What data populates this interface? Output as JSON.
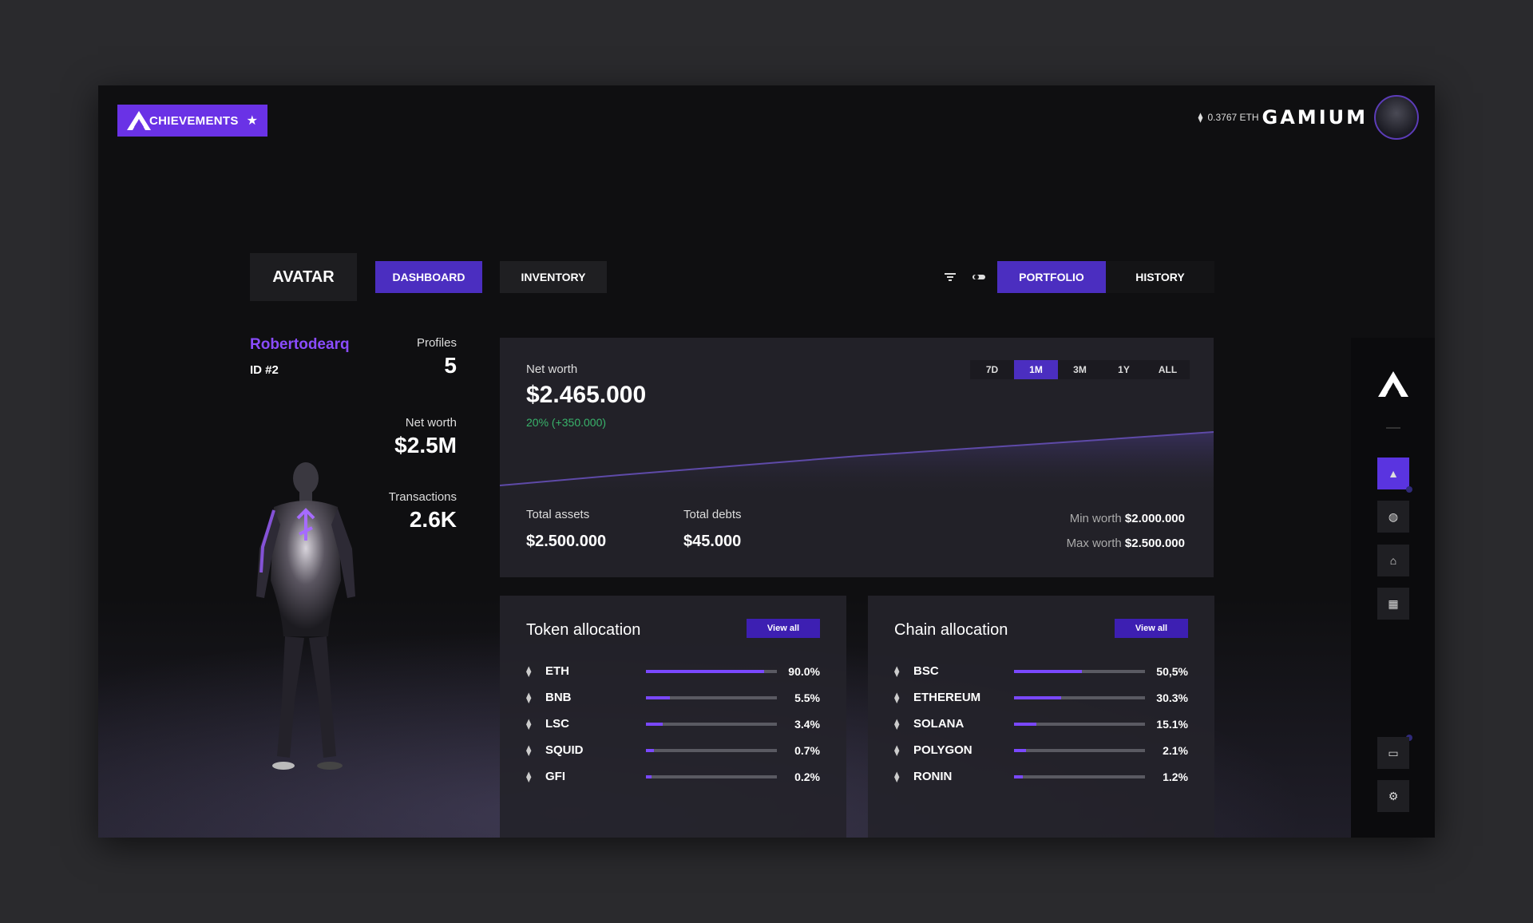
{
  "header": {
    "achievements_label": "CHIEVEMENTS",
    "eth_balance": "0.3767 ETH",
    "brand": "GAMIUM"
  },
  "nav": {
    "avatar": "AVATAR",
    "dashboard": "DASHBOARD",
    "inventory": "INVENTORY",
    "portfolio": "PORTFOLIO",
    "history": "HISTORY"
  },
  "profile": {
    "username": "Robertodearq",
    "id": "ID #2",
    "profiles_label": "Profiles",
    "profiles_value": "5",
    "networth_label": "Net worth",
    "networth_value": "$2.5M",
    "transactions_label": "Transactions",
    "transactions_value": "2.6K"
  },
  "networth": {
    "label": "Net worth",
    "value": "$2.465.000",
    "change": "20% (+350.000)",
    "ranges": [
      "7D",
      "1M",
      "3M",
      "1Y",
      "ALL"
    ],
    "active_range": "1M",
    "total_assets_label": "Total assets",
    "total_assets_value": "$2.500.000",
    "total_debts_label": "Total debts",
    "total_debts_value": "$45.000",
    "min_label": "Min worth",
    "min_value": "$2.000.000",
    "max_label": "Max worth",
    "max_value": "$2.500.000"
  },
  "token_allocation": {
    "title": "Token allocation",
    "view_all": "View all",
    "items": [
      {
        "name": "ETH",
        "pct": "90.0%",
        "fill": 0.9
      },
      {
        "name": "BNB",
        "pct": "5.5%",
        "fill": 0.18
      },
      {
        "name": "LSC",
        "pct": "3.4%",
        "fill": 0.13
      },
      {
        "name": "SQUID",
        "pct": "0.7%",
        "fill": 0.06
      },
      {
        "name": "GFI",
        "pct": "0.2%",
        "fill": 0.04
      }
    ]
  },
  "chain_allocation": {
    "title": "Chain allocation",
    "view_all": "View all",
    "items": [
      {
        "name": "BSC",
        "pct": "50,5%",
        "fill": 0.52
      },
      {
        "name": "ETHEREUM",
        "pct": "30.3%",
        "fill": 0.36
      },
      {
        "name": "SOLANA",
        "pct": "15.1%",
        "fill": 0.17
      },
      {
        "name": "POLYGON",
        "pct": "2.1%",
        "fill": 0.09
      },
      {
        "name": "RONIN",
        "pct": "1.2%",
        "fill": 0.07
      }
    ]
  },
  "colors": {
    "accent": "#6a32e6",
    "accent_dark": "#4b2ec0",
    "positive": "#39b36b",
    "background": "#0f0f11"
  }
}
